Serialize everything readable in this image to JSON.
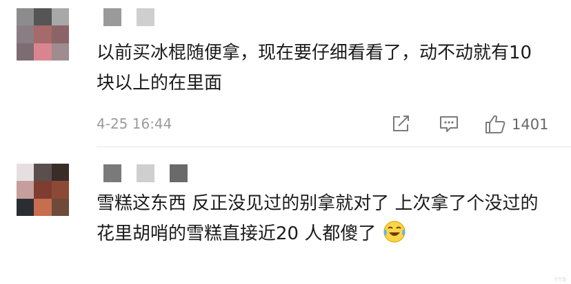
{
  "comments": [
    {
      "text": "以前买冰棍随便拿，现在要仔细看看了，动不动就有10块以上的在里面",
      "time": "4-25 16:44",
      "likes": "1401",
      "avatar_colors": [
        "#8c8c8c",
        "#555555",
        "#a8a8a8",
        "#8a7e84",
        "#a56a6a",
        "#8c6468",
        "#7d6c72",
        "#d98590",
        "#9e8c90"
      ],
      "name_colors": [
        "#9a9a9a",
        "#cfcfcf"
      ]
    },
    {
      "text": "雪糕这东西 反正没见过的别拿就对了 上次拿了个没过的花里胡哨的雪糕直接近20 人都傻了",
      "emoji": "crying-laughing-emoji",
      "avatar_colors": [
        "#e6dfe1",
        "#5a4f4c",
        "#3a2d28",
        "#c69e9c",
        "#7e3d31",
        "#8c4a36",
        "#2a2e33",
        "#c66e4e",
        "#6e4b39"
      ],
      "name_colors": [
        "#7a7a7a",
        "#cfcfcf",
        "#6a6a6a"
      ]
    }
  ],
  "icons": {
    "share": "share-icon",
    "reply": "comment-icon",
    "like": "thumbs-up-icon"
  },
  "watermark": "YYB"
}
